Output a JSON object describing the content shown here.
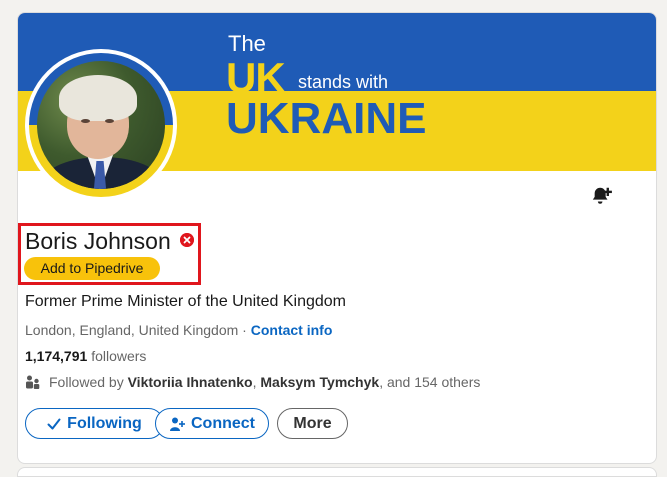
{
  "banner": {
    "line1": "The",
    "line2_big": "UK",
    "line2_small": "stands with",
    "line3": "UKRAINE"
  },
  "profile": {
    "name": "Boris Johnson",
    "pipedrive_button": "Add to Pipedrive",
    "headline": "Former Prime Minister of the United Kingdom",
    "location": "London, England, United Kingdom",
    "separator": "·",
    "contact_info": "Contact info",
    "followers_count": "1,174,791",
    "followers_label": "followers",
    "followed_by_prefix": "Followed by",
    "mutual_1": "Viktoriia Ihnatenko",
    "mutual_sep": ",",
    "mutual_2": "Maksym Tymchyk",
    "followed_by_suffix": ", and 154 others"
  },
  "actions": {
    "following": "Following",
    "connect": "Connect",
    "more": "More"
  },
  "icons": {
    "notification": "bell-plus-icon",
    "close": "x-circle-icon",
    "people": "people-icon",
    "check": "check-icon",
    "add_person": "add-person-icon"
  },
  "colors": {
    "linkedin_blue": "#0a66c2",
    "ukraine_blue": "#1f5bb6",
    "ukraine_yellow": "#f3d21a",
    "pipedrive_yellow": "#f8c20b",
    "highlight_red": "#e0161d"
  }
}
